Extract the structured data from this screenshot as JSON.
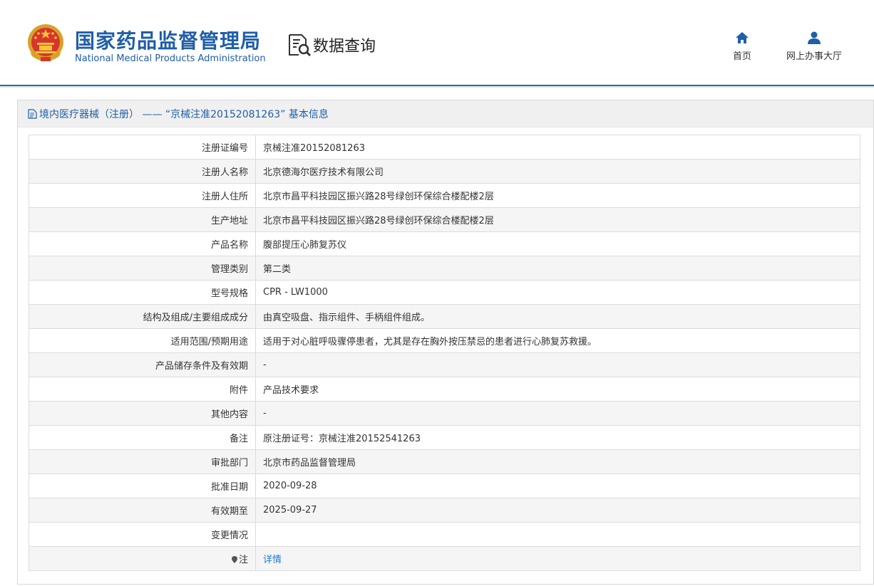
{
  "header": {
    "org_cn": "国家药品监督管理局",
    "org_en": "National Medical Products Administration",
    "section_title": "数据查询",
    "nav": [
      {
        "label": "首页",
        "icon": "home-icon"
      },
      {
        "label": "网上办事大厅",
        "icon": "user-icon"
      }
    ]
  },
  "colors": {
    "brand_blue": "#1f5ea8",
    "rule": "#2d6f98",
    "link": "#1f7ad1"
  },
  "panel": {
    "title": "境内医疗器械（注册） —— “京械注准20152081263” 基本信息",
    "rows": [
      {
        "key": "注册证编号",
        "value": "京械注准20152081263"
      },
      {
        "key": "注册人名称",
        "value": "北京德海尔医疗技术有限公司"
      },
      {
        "key": "注册人住所",
        "value": "北京市昌平科技园区振兴路28号绿创环保综合楼配楼2层"
      },
      {
        "key": "生产地址",
        "value": "北京市昌平科技园区振兴路28号绿创环保综合楼配楼2层"
      },
      {
        "key": "产品名称",
        "value": "腹部提压心肺复苏仪"
      },
      {
        "key": "管理类别",
        "value": "第二类"
      },
      {
        "key": "型号规格",
        "value": "CPR - LW1000"
      },
      {
        "key": "结构及组成/主要组成成分",
        "value": "由真空吸盘、指示组件、手柄组件组成。"
      },
      {
        "key": "适用范围/预期用途",
        "value": "适用于对心脏呼吸骤停患者，尤其是存在胸外按压禁忌的患者进行心肺复苏救援。"
      },
      {
        "key": "产品储存条件及有效期",
        "value": "-"
      },
      {
        "key": "附件",
        "value": "产品技术要求"
      },
      {
        "key": "其他内容",
        "value": "-"
      },
      {
        "key": "备注",
        "value": "原注册证号：京械注准20152541263"
      },
      {
        "key": "审批部门",
        "value": "北京市药品监督管理局"
      },
      {
        "key": "批准日期",
        "value": "2020-09-28"
      },
      {
        "key": "有效期至",
        "value": "2025-09-27"
      },
      {
        "key": "变更情况",
        "value": ""
      }
    ],
    "note_row": {
      "key": "注",
      "value": "详情"
    }
  }
}
